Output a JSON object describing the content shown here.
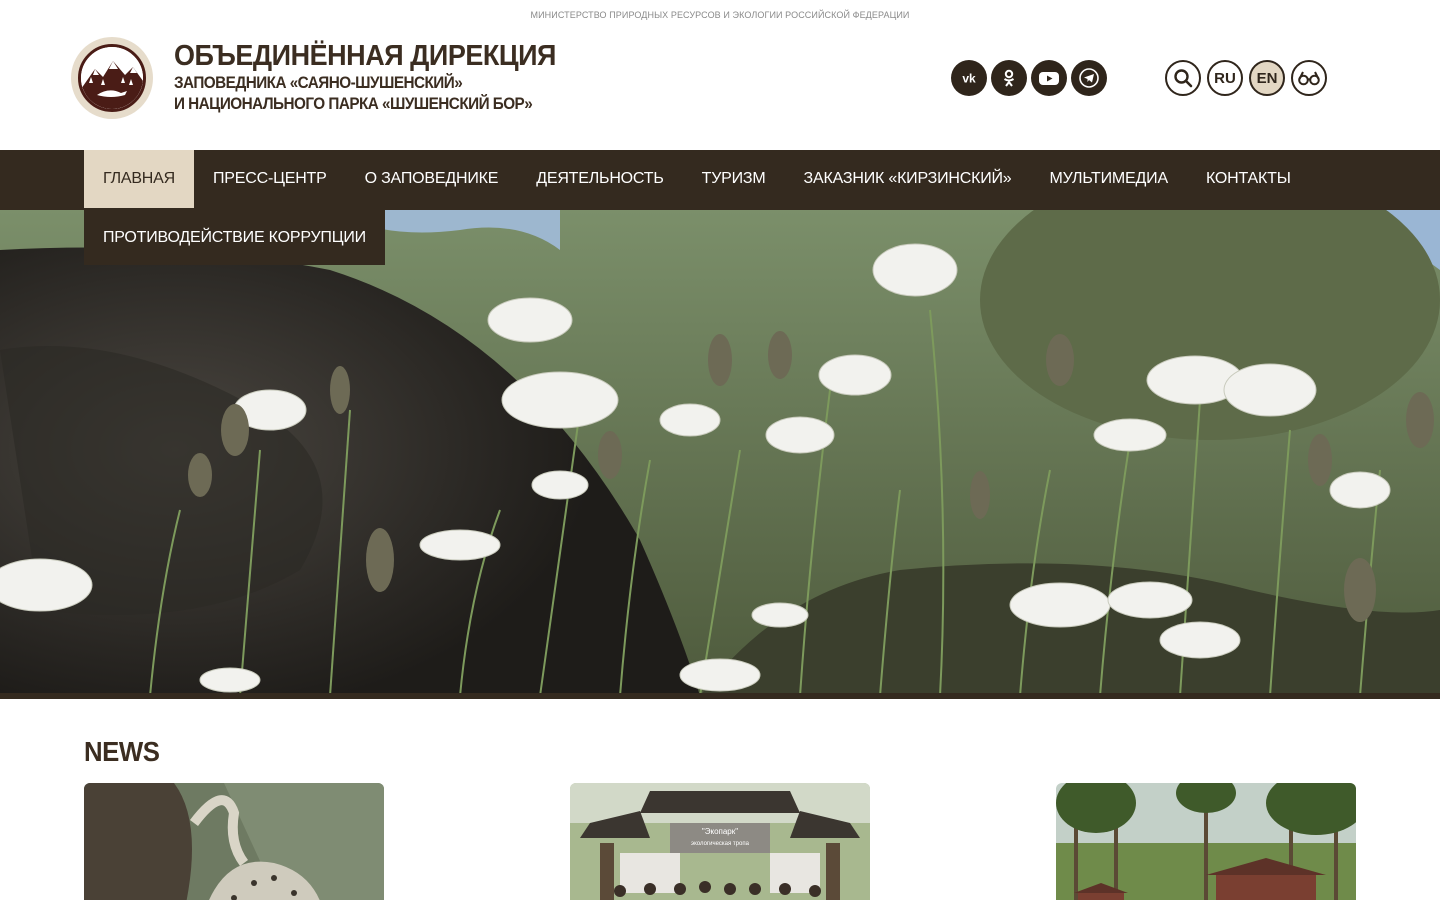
{
  "header": {
    "ministry": "МИНИСТЕРСТВО ПРИРОДНЫХ РЕСУРСОВ И ЭКОЛОГИИ РОССИЙСКОЙ ФЕДЕРАЦИИ",
    "title_line1": "ОБЪЕДИНЁННАЯ ДИРЕКЦИЯ",
    "title_line2": "ЗАПОВЕДНИКА «САЯНО-ШУШЕНСКИЙ»",
    "title_line3": "И НАЦИОНАЛЬНОГО ПАРКА «ШУШЕНСКИЙ БОР»",
    "logo_icon": "mountain-snow-leopard-emblem"
  },
  "social": [
    {
      "name": "vk",
      "icon": "vk-icon"
    },
    {
      "name": "odnoklassniki",
      "icon": "ok-icon"
    },
    {
      "name": "youtube",
      "icon": "youtube-icon"
    },
    {
      "name": "telegram",
      "icon": "telegram-icon"
    }
  ],
  "tools": {
    "search_icon": "search-icon",
    "lang_ru": "RU",
    "lang_en": "EN",
    "active_lang": "EN",
    "accessibility_icon": "glasses-icon"
  },
  "nav": {
    "items": [
      {
        "label": "ГЛАВНАЯ"
      },
      {
        "label": "ПРЕСС-ЦЕНТР"
      },
      {
        "label": "О ЗАПОВЕДНИКЕ"
      },
      {
        "label": "ДЕЯТЕЛЬНОСТЬ"
      },
      {
        "label": "ТУРИЗМ"
      },
      {
        "label": "ЗАКАЗНИК «КИРЗИНСКИЙ»"
      },
      {
        "label": "МУЛЬТИМЕДИА"
      },
      {
        "label": "КОНТАКТЫ"
      }
    ],
    "item_row2": "ПРОТИВОДЕЙСТВИЕ КОРРУПЦИИ",
    "active": "ГЛАВНАЯ"
  },
  "news": {
    "title": "NEWS",
    "cards": [
      {
        "image": "snow-leopard-photo"
      },
      {
        "image": "ecopark-group-photo",
        "sign_text": "\"Экопарк\"",
        "sign_sub": "экологическая тропа"
      },
      {
        "image": "cabins-in-pine-forest-photo"
      }
    ]
  },
  "colors": {
    "dark_brown": "#342a1f",
    "beige_active": "#e3d7c3",
    "text_brown": "#3b2d21"
  }
}
